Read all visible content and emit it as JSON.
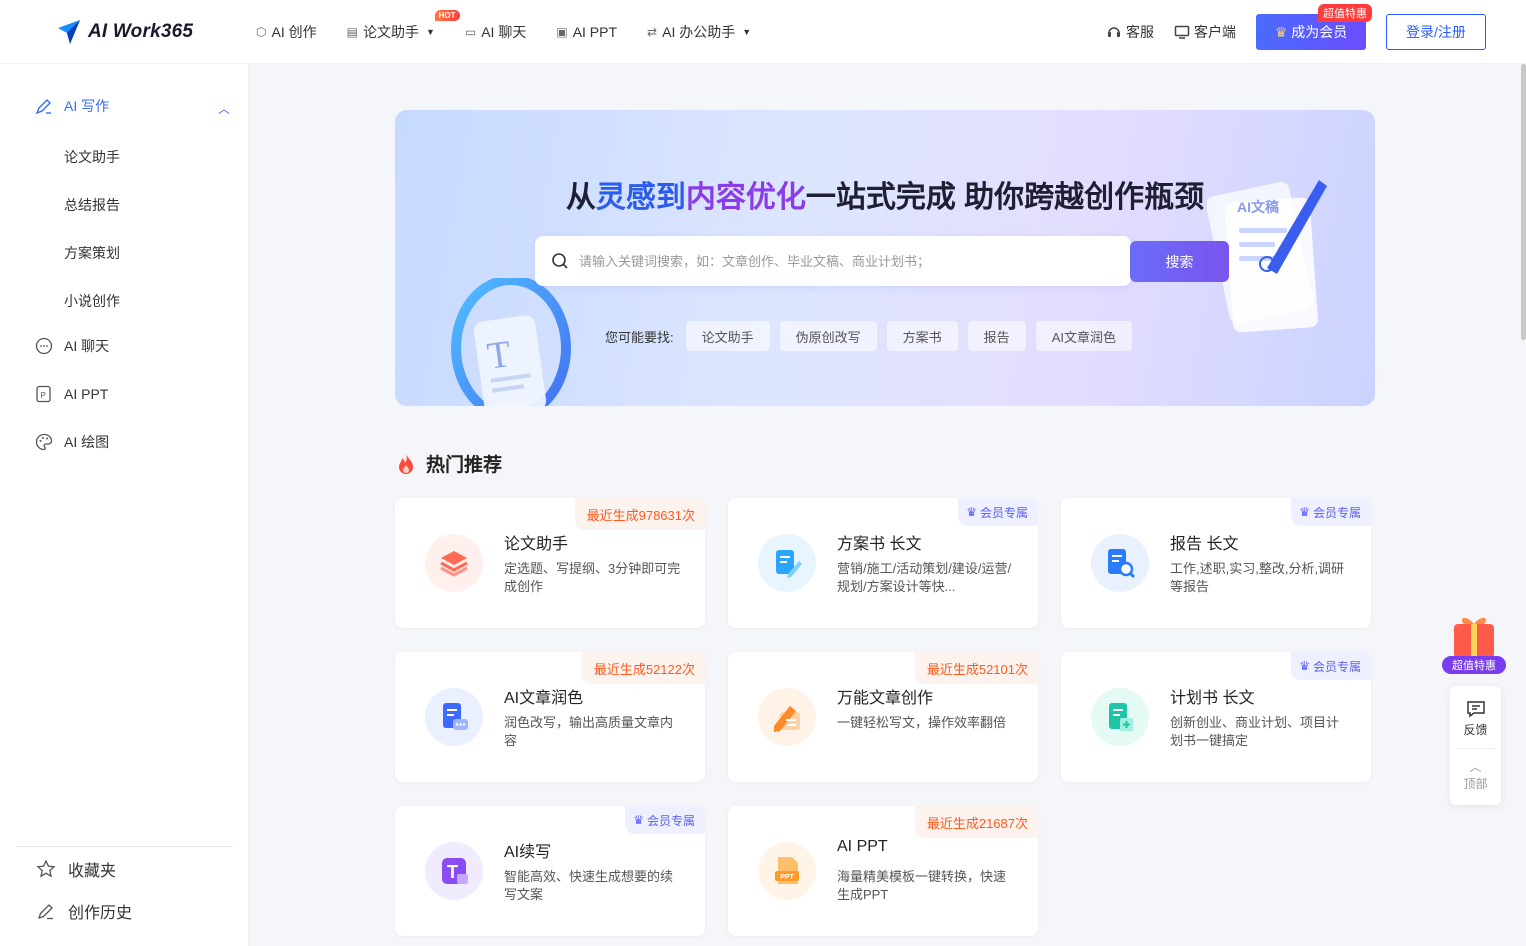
{
  "header": {
    "logo_text": "AI Work365",
    "nav": [
      {
        "label": "AI 创作",
        "icon": "cube-icon",
        "caret": false
      },
      {
        "label": "论文助手",
        "icon": "document-icon",
        "caret": true,
        "badge": "HOT"
      },
      {
        "label": "AI 聊天",
        "icon": "chat-icon",
        "caret": false
      },
      {
        "label": "AI PPT",
        "icon": "ppt-icon",
        "caret": false
      },
      {
        "label": "AI 办公助手",
        "icon": "swap-icon",
        "caret": true
      }
    ],
    "service_label": "客服",
    "client_label": "客户端",
    "vip_label": "成为会员",
    "vip_badge": "超值特惠",
    "login_label": "登录/注册"
  },
  "sidebar": {
    "groups": [
      {
        "label": "AI 写作",
        "icon": "pen-icon",
        "expanded": true,
        "children": [
          "论文助手",
          "总结报告",
          "方案策划",
          "小说创作"
        ]
      },
      {
        "label": "AI 聊天",
        "icon": "chat-bubble-icon"
      },
      {
        "label": "AI PPT",
        "icon": "ppt-file-icon"
      },
      {
        "label": "AI 绘图",
        "icon": "palette-icon"
      }
    ],
    "bottom": [
      {
        "label": "收藏夹",
        "icon": "star-icon"
      },
      {
        "label": "创作历史",
        "icon": "edit-icon"
      }
    ]
  },
  "banner": {
    "title_pre": "从",
    "title_h1": "灵感到",
    "title_h2": "内容优化",
    "title_post": "一站式完成 助你跨越创作瓶颈",
    "search_placeholder": "请输入关键词搜索，如：文章创作、毕业文稿、商业计划书；",
    "search_value": "",
    "search_button": "搜索",
    "suggest_label": "您可能要找:",
    "suggestions": [
      "论文助手",
      "伪原创改写",
      "方案书",
      "报告",
      "AI文章润色"
    ],
    "deco_text": "AI文稿"
  },
  "section": {
    "title": "热门推荐"
  },
  "cards": [
    {
      "title": "论文助手",
      "desc": "定选题、写提纲、3分钟即可完成创作",
      "tag_type": "count",
      "tag": "最近生成978631次",
      "icon": "layers-icon",
      "color": "#ff6a55",
      "bg": "#fff0ed"
    },
    {
      "title": "方案书 长文",
      "desc": "营销/施工/活动策划/建设/运营/规划/方案设计等快...",
      "tag_type": "vip",
      "tag": "会员专属",
      "icon": "doc-edit-icon",
      "color": "#2aa6ff",
      "bg": "#e8f5ff"
    },
    {
      "title": "报告 长文",
      "desc": "工作,述职,实习,整改,分析,调研等报告",
      "tag_type": "vip",
      "tag": "会员专属",
      "icon": "report-search-icon",
      "color": "#2a7cff",
      "bg": "#e9f1ff"
    },
    {
      "title": "AI文章润色",
      "desc": "润色改写，输出高质量文章内容",
      "tag_type": "count",
      "tag": "最近生成52122次",
      "icon": "doc-chat-icon",
      "color": "#3d6bff",
      "bg": "#eaf0ff"
    },
    {
      "title": "万能文章创作",
      "desc": "一键轻松写文，操作效率翻倍",
      "tag_type": "count",
      "tag": "最近生成52101次",
      "icon": "pencil-doc-icon",
      "color": "#ff8a2a",
      "bg": "#fff3e8"
    },
    {
      "title": "计划书 长文",
      "desc": "创新创业、商业计划、项目计划书一键搞定",
      "tag_type": "vip",
      "tag": "会员专属",
      "icon": "plan-doc-icon",
      "color": "#1fc4a6",
      "bg": "#e6faf5"
    },
    {
      "title": "AI续写",
      "desc": "智能高效、快速生成想要的续写文案",
      "tag_type": "vip",
      "tag": "会员专属",
      "icon": "text-continue-icon",
      "color": "#8a4df5",
      "bg": "#f1ebff"
    },
    {
      "title": "AI PPT",
      "desc": "海量精美模板一键转换，快速生成PPT",
      "tag_type": "count",
      "tag": "最近生成21687次",
      "icon": "ppt-doc-icon",
      "color": "#ff9a2a",
      "bg": "#fff4e6"
    }
  ],
  "float": {
    "gift_label": "超值特惠",
    "feedback_label": "反馈",
    "top_label": "顶部"
  }
}
